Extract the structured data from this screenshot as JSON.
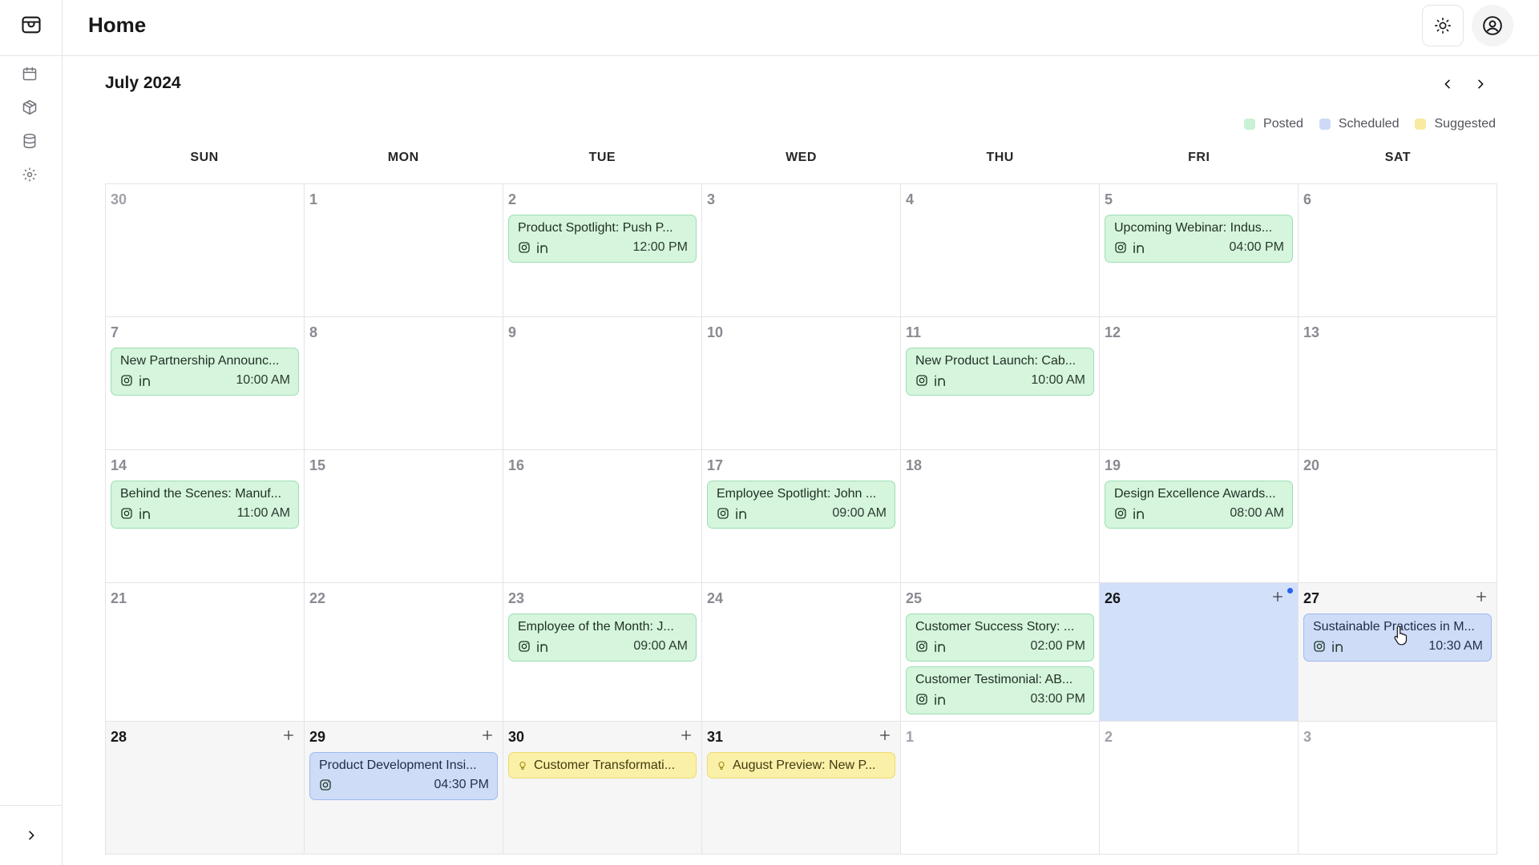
{
  "header": {
    "title": "Home"
  },
  "calendar": {
    "month_label": "July 2024",
    "legend": [
      {
        "label": "Posted",
        "color": "#c9f1d4"
      },
      {
        "label": "Scheduled",
        "color": "#cdd9f7"
      },
      {
        "label": "Suggested",
        "color": "#f8eaa0"
      }
    ],
    "weekdays": [
      "SUN",
      "MON",
      "TUE",
      "WED",
      "THU",
      "FRI",
      "SAT"
    ],
    "cells": [
      {
        "day": "30",
        "kind": "other",
        "events": []
      },
      {
        "day": "1",
        "kind": "past",
        "events": []
      },
      {
        "day": "2",
        "kind": "past",
        "events": [
          {
            "title": "Product Spotlight: Push P...",
            "time": "12:00 PM",
            "status": "posted",
            "platforms": [
              "instagram",
              "linkedin"
            ]
          }
        ]
      },
      {
        "day": "3",
        "kind": "past",
        "events": []
      },
      {
        "day": "4",
        "kind": "past",
        "events": []
      },
      {
        "day": "5",
        "kind": "past",
        "events": [
          {
            "title": "Upcoming Webinar: Indus...",
            "time": "04:00 PM",
            "status": "posted",
            "platforms": [
              "instagram",
              "linkedin"
            ]
          }
        ]
      },
      {
        "day": "6",
        "kind": "past",
        "events": []
      },
      {
        "day": "7",
        "kind": "past",
        "events": [
          {
            "title": "New Partnership Announc...",
            "time": "10:00 AM",
            "status": "posted",
            "platforms": [
              "instagram",
              "linkedin"
            ]
          }
        ]
      },
      {
        "day": "8",
        "kind": "past",
        "events": []
      },
      {
        "day": "9",
        "kind": "past",
        "events": []
      },
      {
        "day": "10",
        "kind": "past",
        "events": []
      },
      {
        "day": "11",
        "kind": "past",
        "events": [
          {
            "title": "New Product Launch: Cab...",
            "time": "10:00 AM",
            "status": "posted",
            "platforms": [
              "instagram",
              "linkedin"
            ]
          }
        ]
      },
      {
        "day": "12",
        "kind": "past",
        "events": []
      },
      {
        "day": "13",
        "kind": "past",
        "events": []
      },
      {
        "day": "14",
        "kind": "past",
        "events": [
          {
            "title": "Behind the Scenes: Manuf...",
            "time": "11:00 AM",
            "status": "posted",
            "platforms": [
              "instagram",
              "linkedin"
            ]
          }
        ]
      },
      {
        "day": "15",
        "kind": "past",
        "events": []
      },
      {
        "day": "16",
        "kind": "past",
        "events": []
      },
      {
        "day": "17",
        "kind": "past",
        "events": [
          {
            "title": "Employee Spotlight: John ...",
            "time": "09:00 AM",
            "status": "posted",
            "platforms": [
              "instagram",
              "linkedin"
            ]
          }
        ]
      },
      {
        "day": "18",
        "kind": "past",
        "events": []
      },
      {
        "day": "19",
        "kind": "past",
        "events": [
          {
            "title": "Design Excellence Awards...",
            "time": "08:00 AM",
            "status": "posted",
            "platforms": [
              "instagram",
              "linkedin"
            ]
          }
        ]
      },
      {
        "day": "20",
        "kind": "past",
        "events": []
      },
      {
        "day": "21",
        "kind": "past",
        "events": []
      },
      {
        "day": "22",
        "kind": "past",
        "events": []
      },
      {
        "day": "23",
        "kind": "past",
        "events": [
          {
            "title": "Employee of the Month: J...",
            "time": "09:00 AM",
            "status": "posted",
            "platforms": [
              "instagram",
              "linkedin"
            ]
          }
        ]
      },
      {
        "day": "24",
        "kind": "past",
        "events": []
      },
      {
        "day": "25",
        "kind": "past",
        "events": [
          {
            "title": "Customer Success Story: ...",
            "time": "02:00 PM",
            "status": "posted",
            "platforms": [
              "instagram",
              "linkedin"
            ]
          },
          {
            "title": "Customer Testimonial: AB...",
            "time": "03:00 PM",
            "status": "posted",
            "platforms": [
              "instagram",
              "linkedin"
            ]
          }
        ]
      },
      {
        "day": "26",
        "kind": "today",
        "events": []
      },
      {
        "day": "27",
        "kind": "future",
        "events": [
          {
            "title": "Sustainable Practices in M...",
            "time": "10:30 AM",
            "status": "scheduled",
            "platforms": [
              "instagram",
              "linkedin"
            ]
          }
        ]
      },
      {
        "day": "28",
        "kind": "future",
        "events": []
      },
      {
        "day": "29",
        "kind": "future",
        "events": [
          {
            "title": "Product Development Insi...",
            "time": "04:30 PM",
            "status": "scheduled",
            "platforms": [
              "instagram"
            ]
          }
        ]
      },
      {
        "day": "30",
        "kind": "future",
        "events": [
          {
            "title": "Customer Transformati...",
            "status": "suggested"
          }
        ]
      },
      {
        "day": "31",
        "kind": "future",
        "events": [
          {
            "title": "August Preview: New P...",
            "status": "suggested"
          }
        ]
      },
      {
        "day": "1",
        "kind": "other",
        "events": []
      },
      {
        "day": "2",
        "kind": "other",
        "events": []
      },
      {
        "day": "3",
        "kind": "other",
        "events": []
      }
    ]
  },
  "icons": {
    "logo": "store-icon",
    "nav": [
      "calendar-icon",
      "package-icon",
      "database-icon",
      "settings-icon"
    ],
    "expand": "chevron-right-icon",
    "theme": "sun-icon",
    "user": "user-circle-icon"
  }
}
